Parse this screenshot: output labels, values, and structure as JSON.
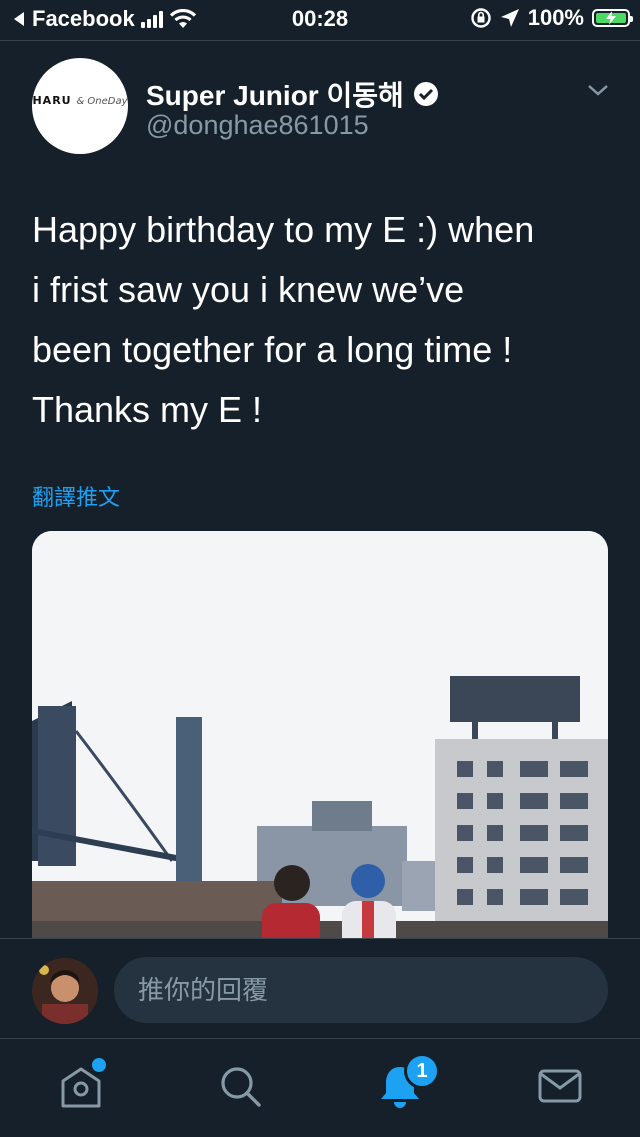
{
  "status_bar": {
    "back_app": "Facebook",
    "time": "00:28",
    "battery": "100%"
  },
  "tweet": {
    "avatar_logo_main": "HARU",
    "avatar_logo_sub": "& OneDay",
    "display_name": "Super Junior 이동해",
    "handle": "@donghae861015",
    "text_lines": [
      "Happy birthday to my E :) when",
      "i frist saw you i knew we’ve",
      "been together for a long time !",
      "Thanks my E !"
    ],
    "translate_label": "翻譯推文"
  },
  "reply": {
    "placeholder": "推你的回覆"
  },
  "tabs": {
    "notifications_badge": "1"
  },
  "colors": {
    "background": "#15202b",
    "accent": "#1da1f2",
    "secondary_text": "#8899a6",
    "input_bg": "#253341",
    "battery_fill": "#4cd964"
  },
  "icons": [
    "back-arrow-icon",
    "signal-icon",
    "wifi-icon",
    "orientation-lock-icon",
    "location-icon",
    "battery-icon",
    "verified-badge-icon",
    "chevron-down-icon",
    "home-icon",
    "search-icon",
    "notifications-icon",
    "messages-icon"
  ]
}
